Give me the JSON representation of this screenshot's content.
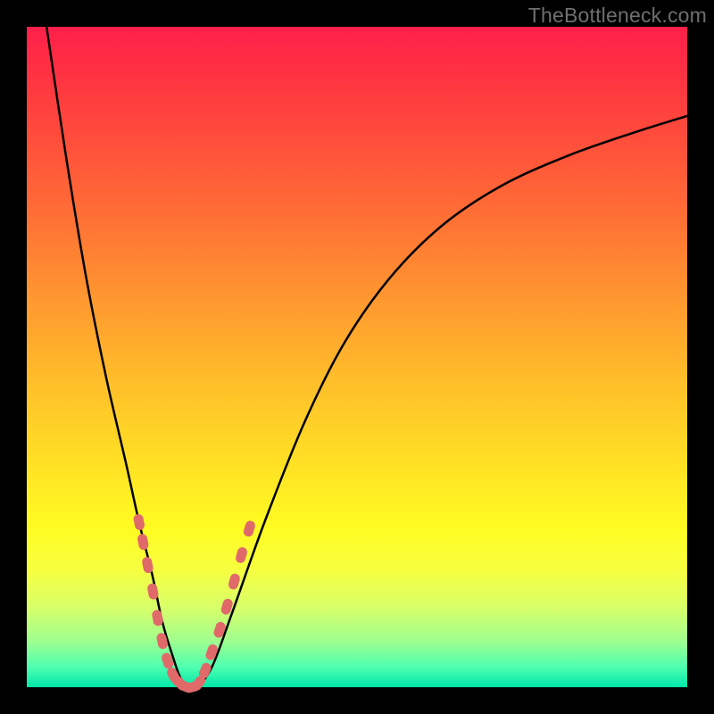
{
  "watermark": "TheBottleneck.com",
  "colors": {
    "background": "#000000",
    "gradient_top": "#ff1f4a",
    "gradient_bottom": "#00e6a8",
    "curve": "#000000",
    "marker": "#e06a6a"
  },
  "chart_data": {
    "type": "line",
    "title": "",
    "xlabel": "",
    "ylabel": "",
    "xlim": [
      0,
      100
    ],
    "ylim": [
      0,
      100
    ],
    "grid": false,
    "note": "Axis values are estimated from pixel position (percent of plot area); no numeric axis labels are shown in the image.",
    "series": [
      {
        "name": "curve",
        "x": [
          3,
          6,
          9,
          12,
          15,
          17,
          19,
          20.5,
          22,
          23.5,
          25.5,
          28,
          31,
          36,
          42,
          48,
          55,
          63,
          72,
          82,
          92,
          100
        ],
        "y": [
          100,
          80,
          62,
          47,
          34,
          25,
          17,
          10,
          5,
          1,
          0,
          3,
          11,
          25,
          40,
          52,
          62,
          70,
          76,
          80.5,
          84,
          86.5
        ]
      },
      {
        "name": "markers",
        "x": [
          17.0,
          17.6,
          18.3,
          19.1,
          19.8,
          20.5,
          21.3,
          22.2,
          23.1,
          24.0,
          25.0,
          26.0,
          27.0,
          28.0,
          29.2,
          30.3,
          31.4,
          32.5,
          33.7
        ],
        "y": [
          25.0,
          22.0,
          18.5,
          14.5,
          10.5,
          7.0,
          4.0,
          1.8,
          0.7,
          0.1,
          0.0,
          0.6,
          2.5,
          5.3,
          8.7,
          12.2,
          16.0,
          20.0,
          24.0
        ]
      }
    ],
    "legend": false
  }
}
